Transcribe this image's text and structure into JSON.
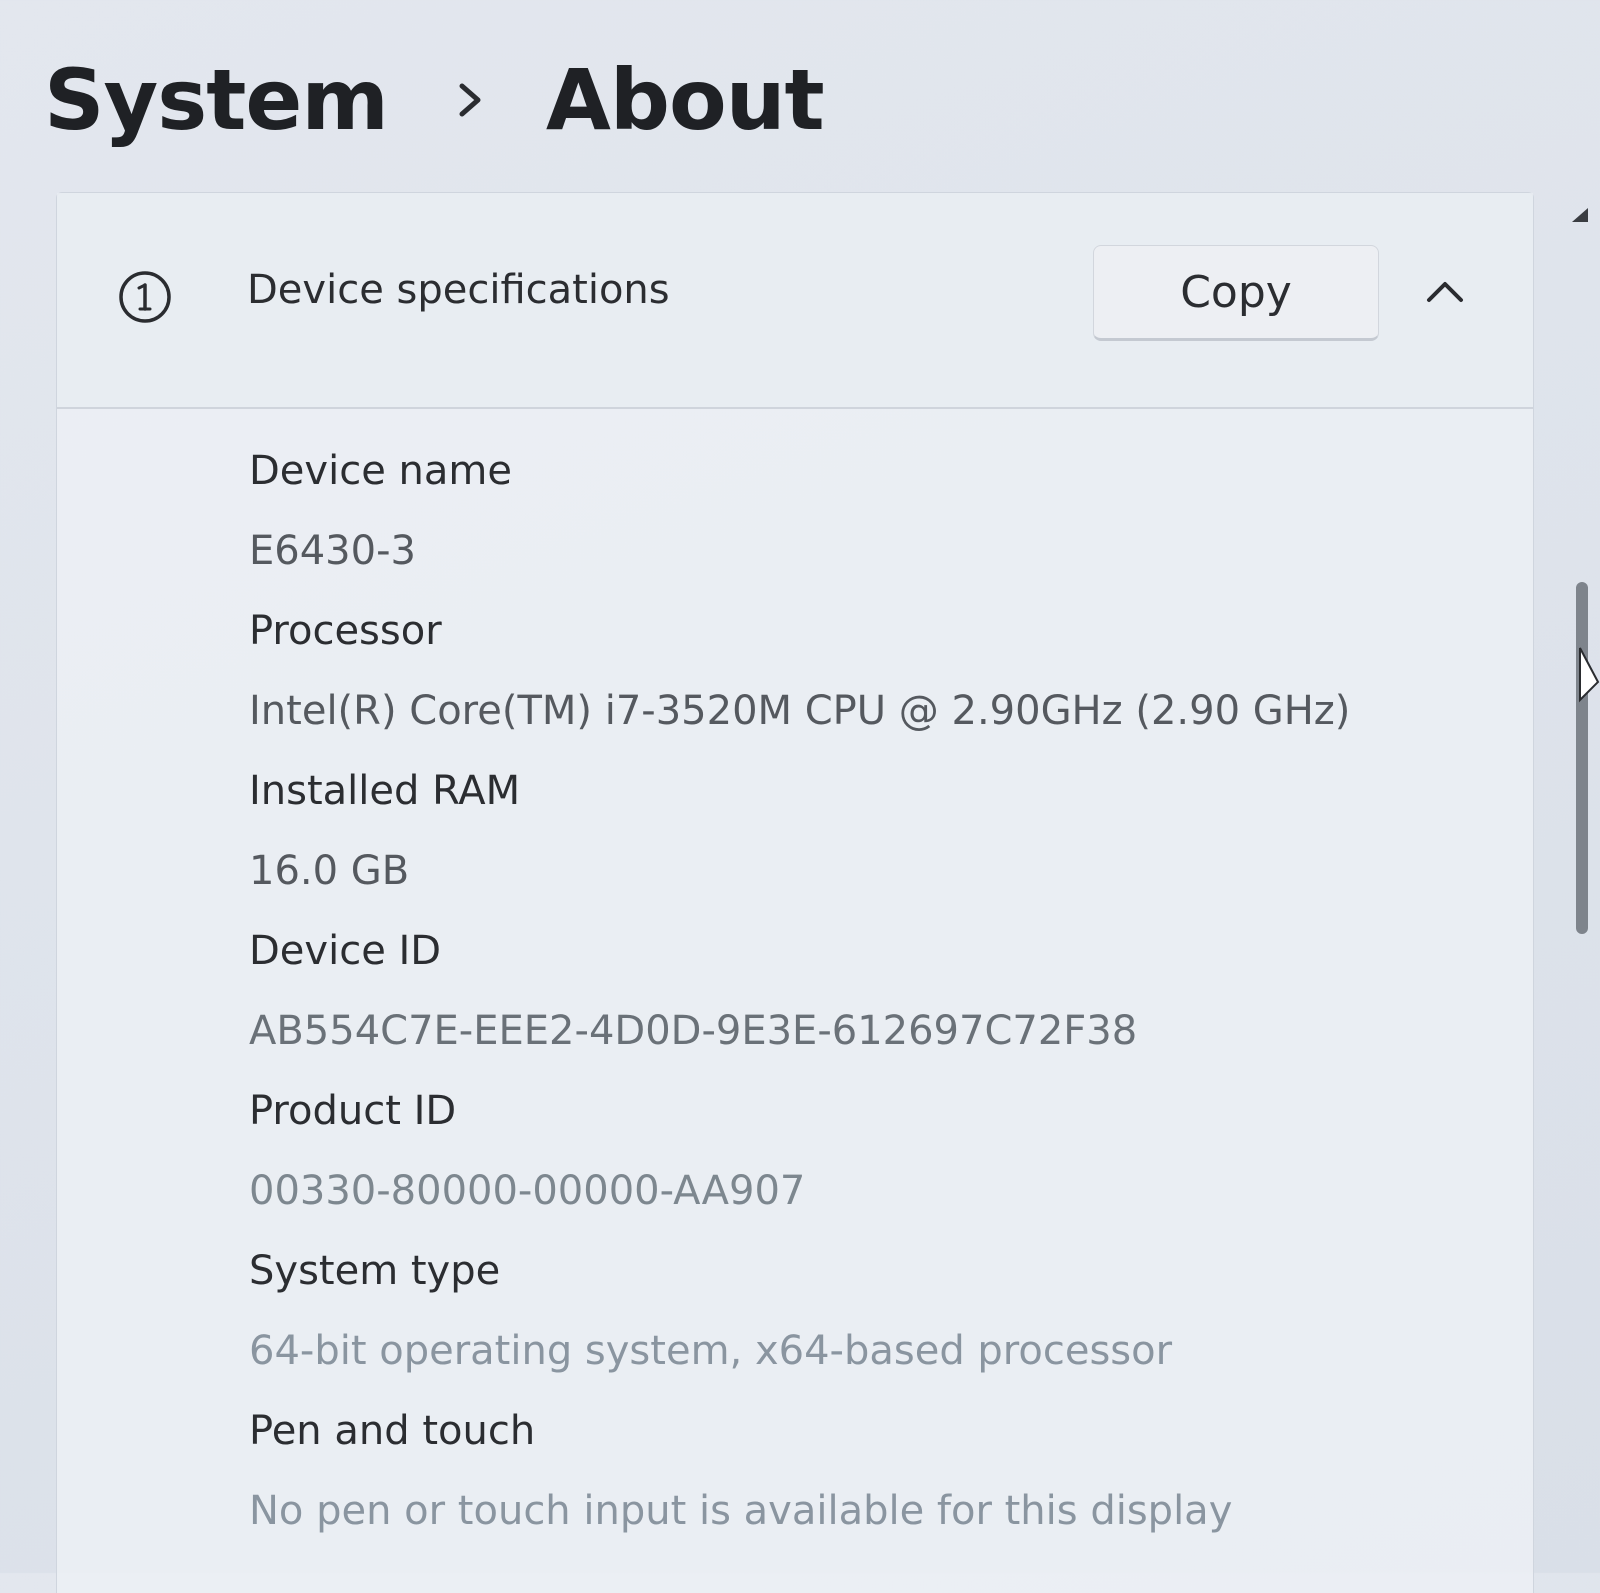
{
  "breadcrumb": {
    "parent": "System",
    "current": "About"
  },
  "device_specifications": {
    "title": "Device specifications",
    "copy_label": "Copy",
    "items": [
      {
        "label": "Device name",
        "value": "E6430-3"
      },
      {
        "label": "Processor",
        "value": "Intel(R) Core(TM) i7-3520M CPU @ 2.90GHz (2.90 GHz)"
      },
      {
        "label": "Installed RAM",
        "value": "16.0 GB"
      },
      {
        "label": "Device ID",
        "value": "AB554C7E-EEE2-4D0D-9E3E-612697C72F38"
      },
      {
        "label": "Product ID",
        "value": "00330-80000-00000-AA907"
      },
      {
        "label": "System type",
        "value": "64-bit operating system, x64-based processor"
      },
      {
        "label": "Pen and touch",
        "value": "No pen or touch input is available for this display"
      }
    ]
  },
  "icons": {
    "info": "info-circle-icon",
    "separator": "chevron-right-icon",
    "collapse": "chevron-up-icon",
    "cursor": "mouse-pointer-icon"
  }
}
